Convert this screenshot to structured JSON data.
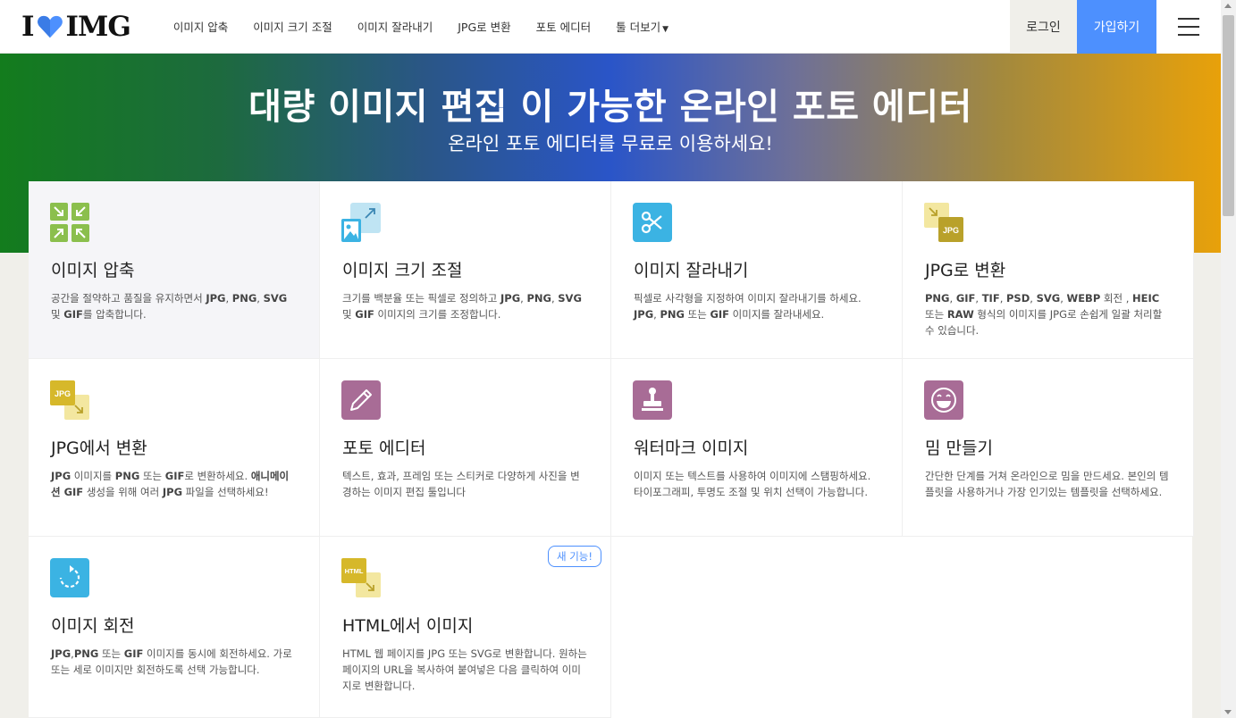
{
  "header": {
    "logo_left": "I",
    "logo_right": "IMG",
    "nav": [
      {
        "label": "이미지 압축"
      },
      {
        "label": "이미지 크기 조절"
      },
      {
        "label": "이미지 잘라내기"
      },
      {
        "label": "JPG로 변환"
      },
      {
        "label": "포토 에디터"
      },
      {
        "label": "툴 더보기"
      }
    ],
    "login": "로그인",
    "signup": "가입하기"
  },
  "hero": {
    "title": "대량 이미지 편집 이 가능한 온라인 포토 에디터",
    "subtitle": "온라인 포토 에디터를 무료로 이용하세요!"
  },
  "tools": [
    {
      "title": "이미지 압축",
      "desc": [
        "공간을 절약하고 품질을 유지하면서 ",
        "JPG",
        ", ",
        "PNG",
        ", ",
        "SVG",
        " 및 ",
        "GIF",
        "를 압축합니다."
      ],
      "icon": "compress-icon",
      "color": "#8bbf4d"
    },
    {
      "title": "이미지 크기 조절",
      "desc": [
        "크기를 백분율 또는 픽셀로 정의하고 ",
        "JPG",
        ", ",
        "PNG",
        ", ",
        "SVG",
        " 및 ",
        "GIF",
        " 이미지의 크기를 조정합니다."
      ],
      "icon": "resize-icon",
      "color": "#76c8e8"
    },
    {
      "title": "이미지 잘라내기",
      "desc": [
        "픽셀로 사각형을 지정하여 이미지 잘라내기를 하세요. ",
        "JPG",
        ", ",
        "PNG",
        " 또는 ",
        "GIF",
        " 이미지를 잘라내세요."
      ],
      "icon": "scissors-icon",
      "color": "#3bb3e3"
    },
    {
      "title": "JPG로 변환",
      "desc": [
        "PNG",
        ", ",
        "GIF",
        ", ",
        "TIF",
        ", ",
        "PSD",
        ", ",
        "SVG",
        ", ",
        "WEBP",
        " 회전 , ",
        "HEIC",
        " 또는 ",
        "RAW",
        " 형식의 이미지를 JPG로 손쉽게 일괄 처리할 수 있습니다."
      ],
      "icon": "to-jpg-icon",
      "color": "#b9a12a"
    },
    {
      "title": "JPG에서 변환",
      "desc": [
        "JPG",
        " 이미지를 ",
        "PNG",
        " 또는 ",
        "GIF",
        "로 변환하세요. ",
        "애니메이션 GIF",
        " 생성을 위해 여러 ",
        "JPG",
        " 파일을 선택하세요!"
      ],
      "icon": "from-jpg-icon",
      "color": "#d6b82a"
    },
    {
      "title": "포토 에디터",
      "desc": [
        "텍스트, 효과, 프레임 또는 스티커로 다양하게 사진을 변경하는 이미지 편집 툴입니다"
      ],
      "icon": "pencil-icon",
      "color": "#a86c96"
    },
    {
      "title": "워터마크 이미지",
      "desc": [
        "이미지 또는 텍스트를 사용하여 이미지에 스탬핑하세요. 타이포그래피, 투명도 조절 및 위치 선택이 가능합니다."
      ],
      "icon": "stamp-icon",
      "color": "#a86c96"
    },
    {
      "title": "밈 만들기",
      "desc": [
        "간단한 단계를 거쳐 온라인으로 밈을 만드세요. 본인의 템플릿을 사용하거나 가장 인기있는 템플릿을 선택하세요."
      ],
      "icon": "meme-face-icon",
      "color": "#a86c96"
    },
    {
      "title": "이미지 회전",
      "desc": [
        "JPG",
        ",",
        "PNG",
        " 또는 ",
        "GIF",
        " 이미지를 동시에 회전하세요. 가로 또는 세로 이미지만 회전하도록 선택 가능합니다."
      ],
      "icon": "rotate-icon",
      "color": "#3bb3e3"
    },
    {
      "title": "HTML에서 이미지",
      "desc": [
        "HTML 웹 페이지를 JPG 또는 SVG로 변환합니다. 원하는 페이지의 URL을 복사하여 붙여넣은 다음 클릭하여 이미지로 변환합니다."
      ],
      "icon": "html-to-image-icon",
      "color": "#d6b82a",
      "badge": "새 기능!"
    }
  ]
}
